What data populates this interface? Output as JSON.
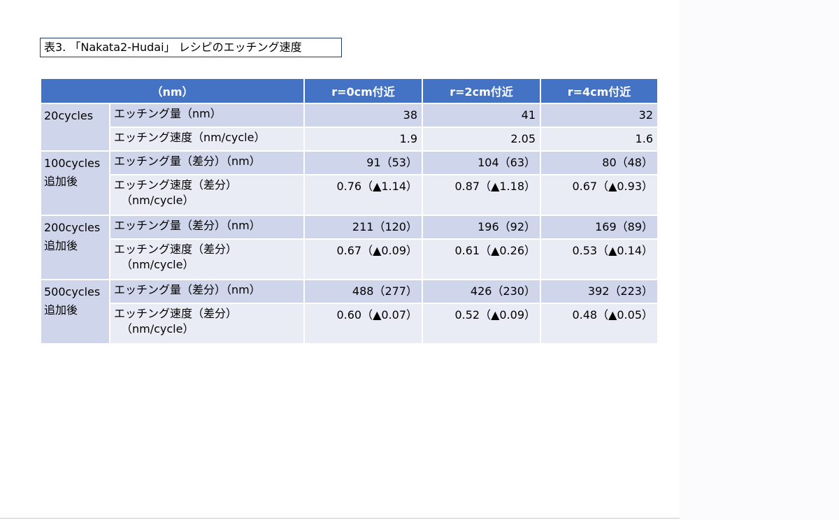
{
  "caption": "表3. 「Nakata2-Hudai」 レシピのエッチング速度",
  "table": {
    "header": {
      "unit": "（nm）",
      "columns": [
        "r=0cm付近",
        "r=2cm付近",
        "r=4cm付近"
      ]
    },
    "groups": [
      {
        "name_line1": "20cycles",
        "name_line2": "",
        "rows": [
          {
            "label": "エッチング量（nm）",
            "label2": "",
            "values": [
              "38",
              "41",
              "32"
            ]
          },
          {
            "label": "エッチング速度（nm/cycle）",
            "label2": "",
            "values": [
              "1.9",
              "2.05",
              "1.6"
            ]
          }
        ]
      },
      {
        "name_line1": "100cycles",
        "name_line2": "追加後",
        "rows": [
          {
            "label": "エッチング量（差分）（nm）",
            "label2": "",
            "values": [
              "91（53）",
              "104（63）",
              "80（48）"
            ]
          },
          {
            "label": "エッチング速度（差分）",
            "label2": "（nm/cycle）",
            "values": [
              "0.76（▲1.14）",
              "0.87（▲1.18）",
              "0.67（▲0.93）"
            ]
          }
        ]
      },
      {
        "name_line1": "200cycles",
        "name_line2": "追加後",
        "rows": [
          {
            "label": "エッチング量（差分）（nm）",
            "label2": "",
            "values": [
              "211（120）",
              "196（92）",
              "169（89）"
            ]
          },
          {
            "label": "エッチング速度（差分）",
            "label2": "（nm/cycle）",
            "values": [
              "0.67（▲0.09）",
              "0.61（▲0.26）",
              "0.53（▲0.14）"
            ]
          }
        ]
      },
      {
        "name_line1": "500cycles",
        "name_line2": "追加後",
        "rows": [
          {
            "label": "エッチング量（差分）（nm）",
            "label2": "",
            "values": [
              "488（277）",
              "426（230）",
              "392（223）"
            ]
          },
          {
            "label": "エッチング速度（差分）",
            "label2": "（nm/cycle）",
            "values": [
              "0.60（▲0.07）",
              "0.52（▲0.09）",
              "0.48（▲0.05）"
            ]
          }
        ]
      }
    ]
  },
  "colors": {
    "header_bg": "#4472c4",
    "dark_row": "#cfd5ea",
    "light_row": "#e9ebf5",
    "caption_border": "#1f3864"
  }
}
